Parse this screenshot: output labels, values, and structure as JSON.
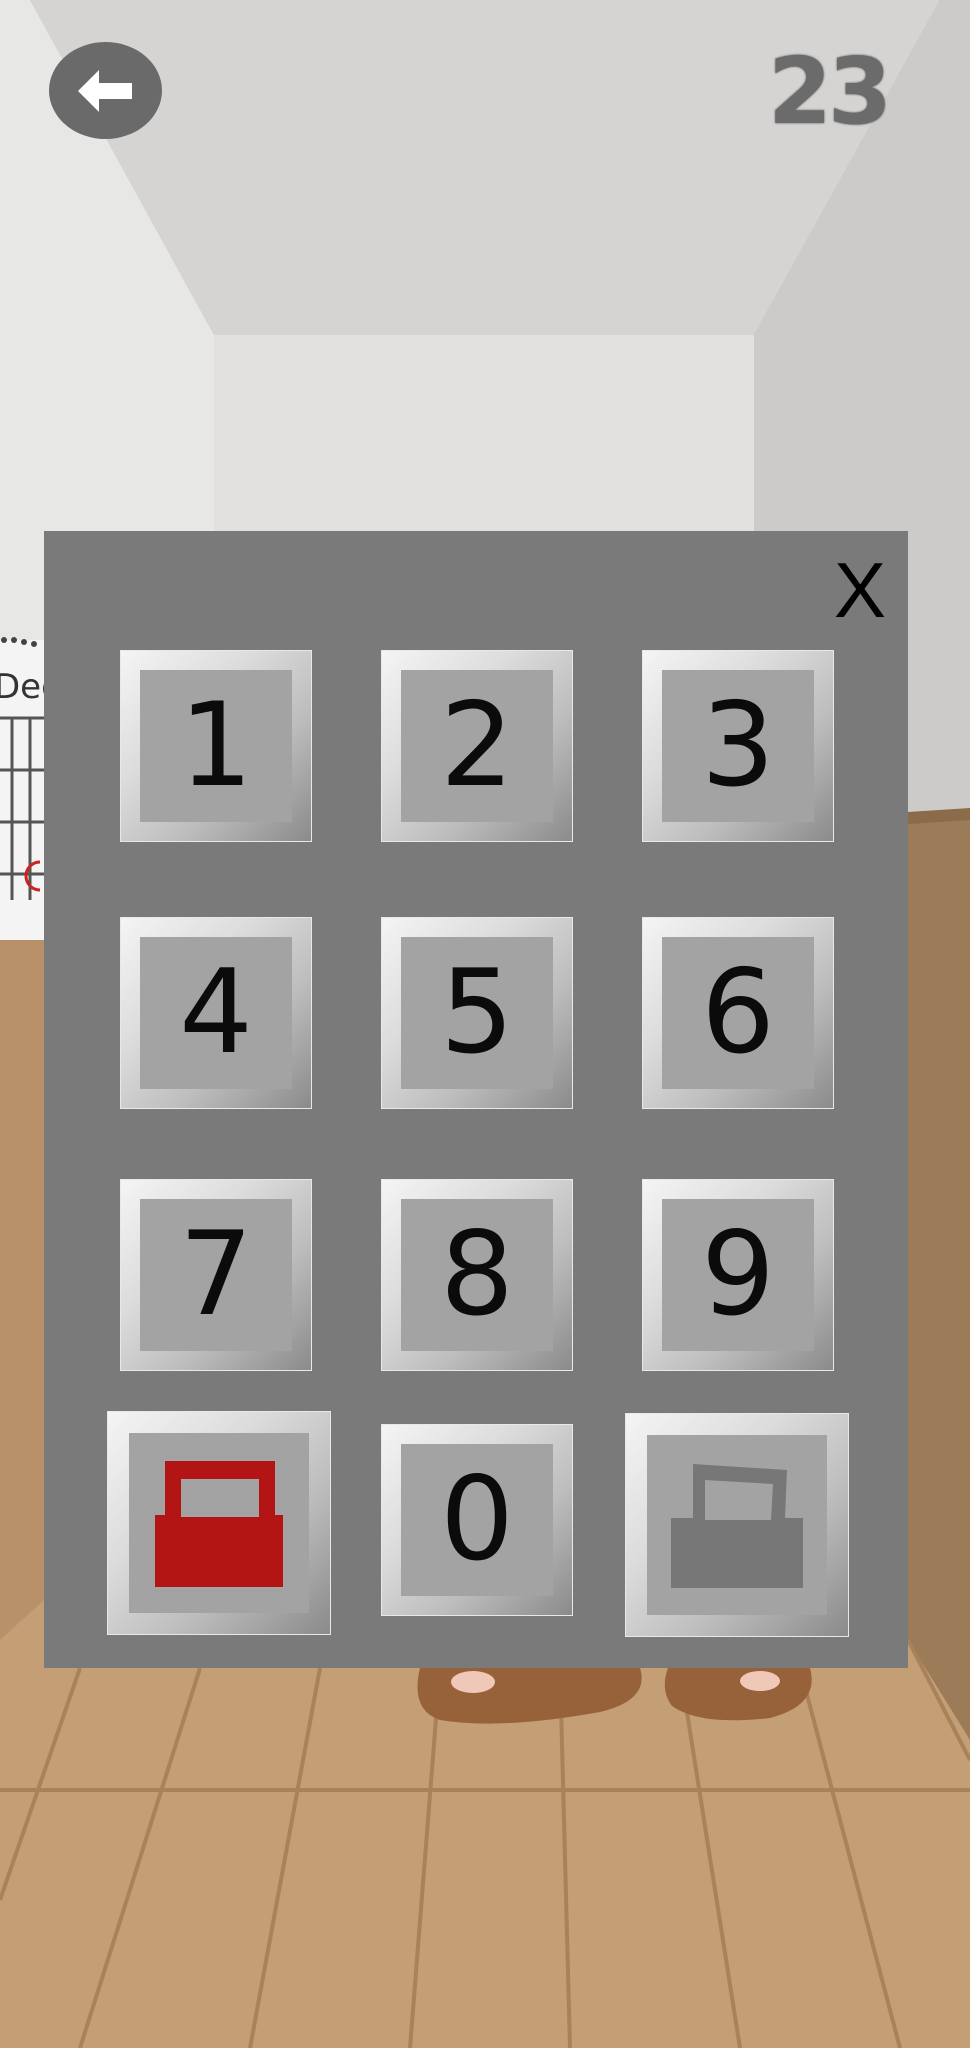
{
  "header": {
    "back_icon": "back-arrow-icon",
    "level": "23"
  },
  "room": {
    "calendar_label": "Dec"
  },
  "keypad": {
    "close_label": "X",
    "keys": [
      "1",
      "2",
      "3",
      "4",
      "5",
      "6",
      "7",
      "8",
      "9",
      "0"
    ],
    "delete_icon": "red-toolbox-icon",
    "enter_icon": "gray-toolbox-icon"
  },
  "colors": {
    "panel": "#7a7a7a",
    "key_face": "#a3a3a3",
    "delete_accent": "#b31414",
    "enter_accent": "#777777",
    "floor": "#c49e74"
  }
}
